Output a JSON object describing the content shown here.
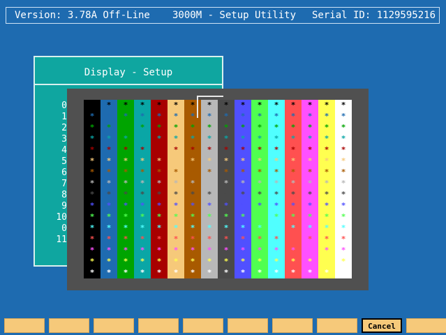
{
  "header": {
    "version": "Version: 3.78A Off-Line",
    "title": "3000M - Setup Utility",
    "serial": "Serial ID: 1129595216"
  },
  "setup_window": {
    "title": "Display - Setup",
    "row_labels": [
      "0",
      "1",
      "2",
      "3",
      "4",
      "5",
      "6",
      "7",
      "8",
      "9",
      "10",
      "0",
      "11"
    ]
  },
  "palette": {
    "colors": [
      "#000000",
      "#1e6bb0",
      "#00a400",
      "#0aa6a6",
      "#a80000",
      "#f6c97a",
      "#a85a00",
      "#b8b8b8",
      "#4a4a4a",
      "#5050ff",
      "#50ff50",
      "#50ffff",
      "#ff5050",
      "#ff50ff",
      "#ffff50",
      "#ffffff"
    ],
    "glyph": "*",
    "selected_column": 7
  },
  "function_keys": {
    "labels": [
      "",
      "",
      "",
      "",
      "",
      "",
      "",
      "",
      "Cancel",
      ""
    ],
    "outlined_index": 8
  }
}
